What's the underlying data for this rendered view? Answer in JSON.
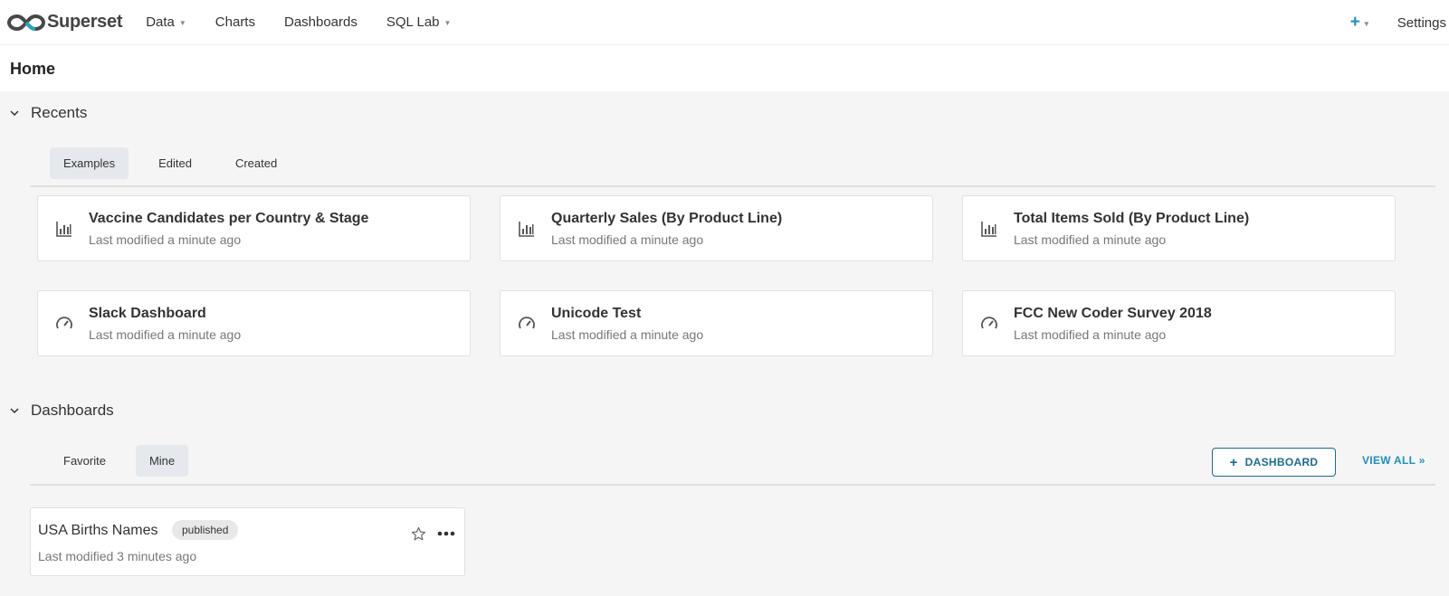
{
  "nav": {
    "brand": "Superset",
    "menu": [
      {
        "label": "Data",
        "caret": true
      },
      {
        "label": "Charts",
        "caret": false
      },
      {
        "label": "Dashboards",
        "caret": false
      },
      {
        "label": "SQL Lab",
        "caret": true
      }
    ],
    "plus_icon": "plus-icon",
    "settings": "Settings"
  },
  "page_title": "Home",
  "recents": {
    "header": "Recents",
    "tabs": [
      {
        "label": "Examples",
        "active": true
      },
      {
        "label": "Edited",
        "active": false
      },
      {
        "label": "Created",
        "active": false
      }
    ],
    "cards": [
      {
        "title": "Vaccine Candidates per Country & Stage",
        "subtitle": "Last modified a minute ago",
        "icon": "bar-chart-icon"
      },
      {
        "title": "Quarterly Sales (By Product Line)",
        "subtitle": "Last modified a minute ago",
        "icon": "bar-chart-icon"
      },
      {
        "title": "Total Items Sold (By Product Line)",
        "subtitle": "Last modified a minute ago",
        "icon": "bar-chart-icon"
      },
      {
        "title": "Slack Dashboard",
        "subtitle": "Last modified a minute ago",
        "icon": "dashboard-gauge-icon"
      },
      {
        "title": "Unicode Test",
        "subtitle": "Last modified a minute ago",
        "icon": "dashboard-gauge-icon"
      },
      {
        "title": "FCC New Coder Survey 2018",
        "subtitle": "Last modified a minute ago",
        "icon": "dashboard-gauge-icon"
      }
    ]
  },
  "dashboards": {
    "header": "Dashboards",
    "tabs": [
      {
        "label": "Favorite",
        "active": false
      },
      {
        "label": "Mine",
        "active": true
      }
    ],
    "add_button": "DASHBOARD",
    "view_all": "VIEW ALL »",
    "items": [
      {
        "title": "USA Births Names",
        "badge": "published",
        "subtitle": "Last modified 3 minutes ago"
      }
    ]
  },
  "colors": {
    "accent": "#1f8fbf",
    "button_border": "#1a6c8f",
    "background": "#f5f5f5"
  }
}
